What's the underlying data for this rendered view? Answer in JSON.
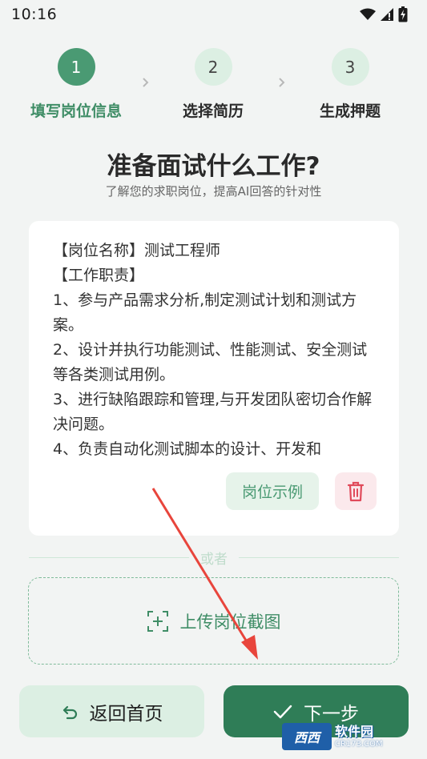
{
  "status_bar": {
    "time": "10:16"
  },
  "stepper": {
    "steps": [
      {
        "number": "1",
        "label": "填写岗位信息"
      },
      {
        "number": "2",
        "label": "选择简历"
      },
      {
        "number": "3",
        "label": "生成押题"
      }
    ],
    "active_index": 0
  },
  "header": {
    "title": "准备面试什么工作?",
    "subtitle": "了解您的求职岗位，提高AI回答的针对性"
  },
  "job_card": {
    "lines": [
      "【岗位名称】测试工程师",
      "【工作职责】",
      "1、参与产品需求分析,制定测试计划和测试方案。",
      "2、设计并执行功能测试、性能测试、安全测试等各类测试用例。",
      "3、进行缺陷跟踪和管理,与开发团队密切合作解决问题。",
      "4、负责自动化测试脚本的设计、开发和"
    ],
    "example_button": "岗位示例"
  },
  "divider": {
    "text": "或者"
  },
  "upload": {
    "label": "上传岗位截图"
  },
  "footer": {
    "home_button": "返回首页",
    "next_button": "下一步"
  },
  "watermark": {
    "name": "软件园",
    "url": "CR173.COM",
    "logo": "西西"
  },
  "colors": {
    "primary": "#2f7d57",
    "accent": "#4a9a73",
    "light_green": "#dcefe3",
    "danger": "#e04a5a",
    "annotation_red": "#e8453c"
  }
}
